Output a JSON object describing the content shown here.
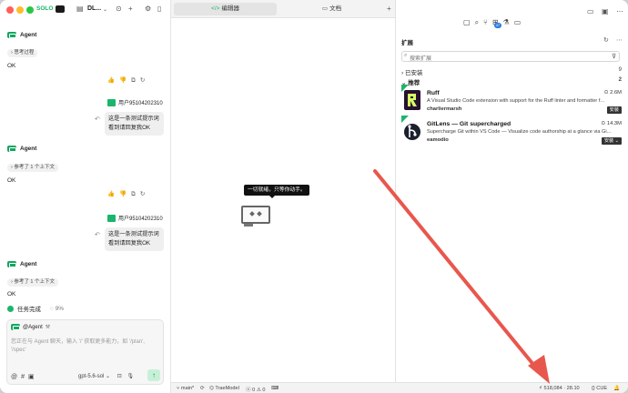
{
  "titlebar": {
    "brand": "SOLO",
    "project": "DL..."
  },
  "chat": {
    "messages": [
      {
        "role": "agent",
        "name": "Agent",
        "chip": "思考过程",
        "text": "OK"
      },
      {
        "role": "user",
        "name": "用户95104202310",
        "text": "这是一条测试提示词看到请回复我OK"
      },
      {
        "role": "agent",
        "name": "Agent",
        "chip": "参考了 1 个上下文",
        "text": "OK"
      },
      {
        "role": "user",
        "name": "用户95104202310",
        "text": "这是一条测试提示词看到请回复我OK"
      },
      {
        "role": "agent",
        "name": "Agent",
        "chip": "参考了 1 个上下文",
        "text": "OK"
      }
    ],
    "task": {
      "label": "任务完成",
      "progress": "9%"
    },
    "composer": {
      "mention": "@Agent",
      "placeholder": "您正在与 Agent 聊天，输入 '/' 获取更多能力，如 '/plan', '/spec'",
      "model": "gpt-5.6-sol"
    }
  },
  "editor": {
    "tabs": [
      {
        "label": "编辑器",
        "active": true
      },
      {
        "label": "文档",
        "active": false
      }
    ],
    "empty_tooltip": "一切就绪，只等你动手。"
  },
  "extensions": {
    "title": "扩展",
    "search_placeholder": "搜索扩展",
    "sections": [
      {
        "label": "已安装",
        "count": "9",
        "expanded": false
      },
      {
        "label": "推荐",
        "count": "2",
        "expanded": true
      }
    ],
    "items": [
      {
        "name": "Ruff",
        "description": "A Visual Studio Code extension with support for the Ruff linter and formatter f...",
        "author": "charliermarsh",
        "downloads": "2.6M",
        "action": "安装"
      },
      {
        "name": "GitLens — Git supercharged",
        "description": "Supercharge Git within VS Code — Visualize code authorship at a glance via Gi...",
        "author": "eamodio",
        "downloads": "14.3M",
        "action": "安装"
      }
    ]
  },
  "statusbar": {
    "branch": "main*",
    "sync": "TraeModel",
    "errors": "0",
    "warnings": "0",
    "cursor": "518,084 · 28.10",
    "language": "CUE"
  },
  "colors": {
    "accent": "#1bb56b",
    "annotation_arrow": "#e8574d",
    "badge": "#2a7be4"
  }
}
